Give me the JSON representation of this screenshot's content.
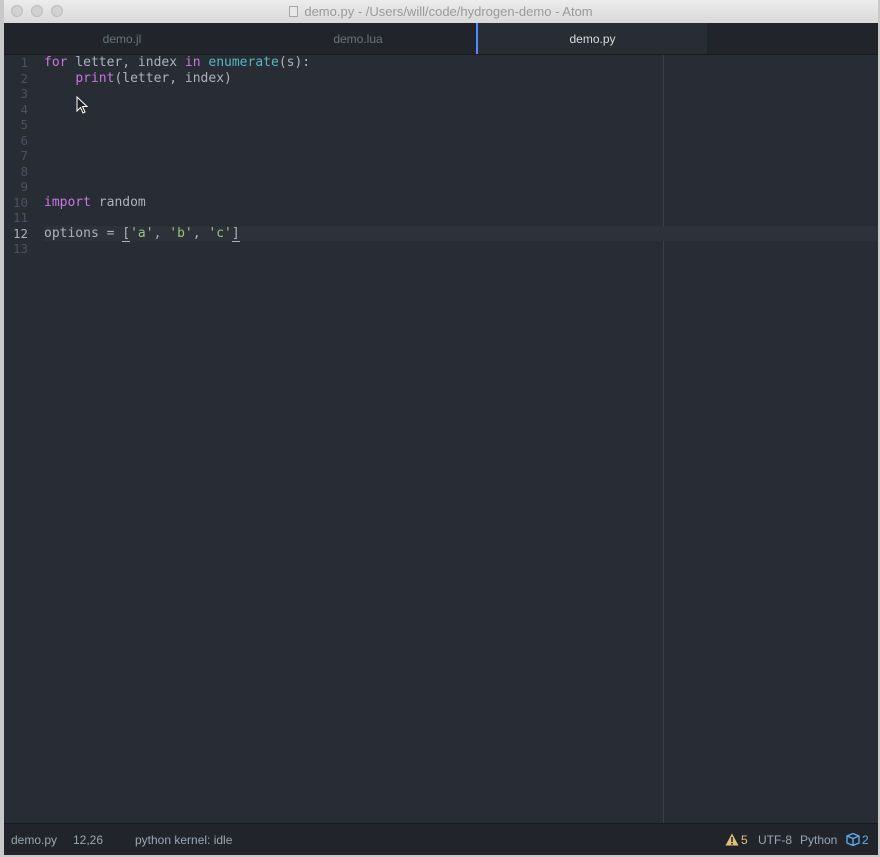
{
  "window": {
    "title": "demo.py - /Users/will/code/hydrogen-demo - Atom"
  },
  "tabs": [
    {
      "label": "demo.jl"
    },
    {
      "label": "demo.lua"
    },
    {
      "label": "demo.py"
    }
  ],
  "editor": {
    "line_numbers": [
      "1",
      "2",
      "3",
      "4",
      "5",
      "6",
      "7",
      "8",
      "9",
      "10",
      "11",
      "12",
      "13"
    ],
    "active_line": 12
  },
  "code": {
    "l1": {
      "kw_for": "for",
      "t1": " letter, index ",
      "kw_in": "in",
      "sp": " ",
      "fn": "enumerate",
      "rest": "(s):"
    },
    "l2": {
      "indent": "    ",
      "fn": "print",
      "rest": "(letter, index)"
    },
    "l10": {
      "kw": "import",
      "rest": " random"
    },
    "l12": {
      "t1": "options = ",
      "b_open": "[",
      "s1": "'a'",
      "c1": ", ",
      "s2": "'b'",
      "c2": ", ",
      "s3": "'c'",
      "b_close": "]"
    }
  },
  "status": {
    "file": "demo.py",
    "position": "12,26",
    "kernel": "python kernel: idle",
    "warnings": "5",
    "encoding": "UTF-8",
    "grammar": "Python",
    "updates": "2"
  },
  "colors": {
    "keyword": "#c678dd",
    "function": "#56b6c2",
    "string": "#98c379",
    "accent": "#528bff",
    "warning": "#e5c07b"
  }
}
